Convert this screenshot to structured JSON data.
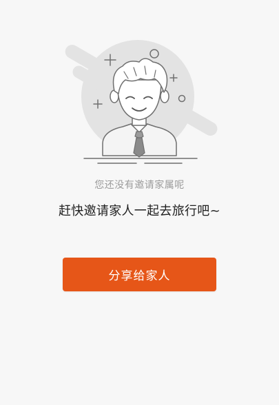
{
  "empty_state": {
    "illustration_icon": "person-with-tie-icon",
    "hint": "您还没有邀请家属呢",
    "headline": "赶快邀请家人一起去旅行吧~",
    "share_button_label": "分享给家人"
  },
  "colors": {
    "background": "#f7f7f7",
    "accent": "#e65618",
    "illustration_gray": "#e3e3e3",
    "line_gray": "#6f6f6f"
  }
}
